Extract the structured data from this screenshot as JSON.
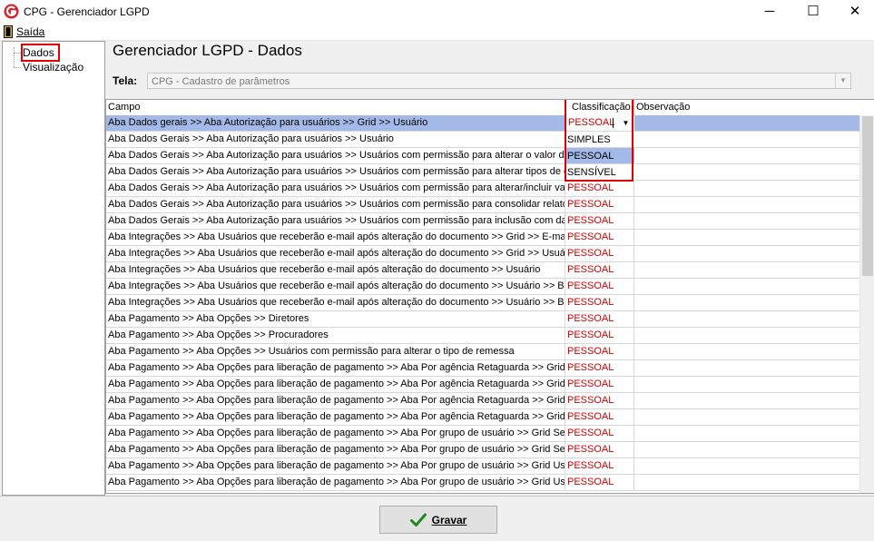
{
  "window": {
    "title": "CPG - Gerenciador LGPD",
    "minimize": "─",
    "maximize": "☐",
    "close": "✕"
  },
  "menu": {
    "exit_label": "Saída"
  },
  "tree": {
    "items": [
      "Dados",
      "Visualização"
    ]
  },
  "page": {
    "title": "Gerenciador LGPD - Dados",
    "tela_label": "Tela:",
    "tela_value": "CPG - Cadastro de parâmetros"
  },
  "grid": {
    "columns": [
      "Campo",
      "Classificação",
      "Observação"
    ],
    "rows": [
      {
        "campo": "Aba Dados gerais >> Aba Autorização para usuários >> Grid >> Usuário",
        "classificacao": "PESSOAL"
      },
      {
        "campo": "Aba Dados Gerais >> Aba Autorização para usuários >> Usuário",
        "classificacao": "PESSOAL"
      },
      {
        "campo": "Aba Dados Gerais >> Aba Autorização para usuários >> Usuários com permissão para alterar o valor de l...",
        "classificacao": "PESSOAL"
      },
      {
        "campo": "Aba Dados Gerais >> Aba Autorização para usuários >> Usuários com permissão para alterar tipos de de...",
        "classificacao": "PESSOAL"
      },
      {
        "campo": "Aba Dados Gerais >> Aba Autorização para usuários >> Usuários com permissão para alterar/incluir valor...",
        "classificacao": "PESSOAL"
      },
      {
        "campo": "Aba Dados Gerais >> Aba Autorização para usuários >> Usuários com permissão para consolidar relatóri...",
        "classificacao": "PESSOAL"
      },
      {
        "campo": "Aba Dados Gerais >> Aba Autorização para usuários >> Usuários com permissão para inclusão com data...",
        "classificacao": "PESSOAL"
      },
      {
        "campo": "Aba Integrações  >> Aba Usuários que receberão e-mail após alteração do documento >> Grid >> E-mail",
        "classificacao": "PESSOAL"
      },
      {
        "campo": "Aba Integrações  >> Aba Usuários que receberão e-mail após alteração do documento >> Grid >> Usuário",
        "classificacao": "PESSOAL"
      },
      {
        "campo": "Aba Integrações >> Aba Usuários que receberão e-mail após alteração do documento >> Usuário",
        "classificacao": "PESSOAL"
      },
      {
        "campo": "Aba Integrações >> Aba Usuários que receberão e-mail após alteração do documento >> Usuário >> Bro...",
        "classificacao": "PESSOAL"
      },
      {
        "campo": "Aba Integrações >> Aba Usuários que receberão e-mail após alteração do documento >> Usuário >> Bro...",
        "classificacao": "PESSOAL"
      },
      {
        "campo": "Aba Pagamento >> Aba Opções >> Diretores",
        "classificacao": "PESSOAL"
      },
      {
        "campo": "Aba Pagamento >> Aba Opções >> Procuradores",
        "classificacao": "PESSOAL"
      },
      {
        "campo": "Aba Pagamento >> Aba Opções >> Usuários com permissão para alterar o tipo de remessa",
        "classificacao": "PESSOAL"
      },
      {
        "campo": "Aba Pagamento >> Aba Opções para liberação de pagamento >> Aba Por agência Retaguarda >> Grid ...",
        "classificacao": "PESSOAL"
      },
      {
        "campo": "Aba Pagamento >> Aba Opções para liberação de pagamento >> Aba Por agência Retaguarda >> Grid ...",
        "classificacao": "PESSOAL"
      },
      {
        "campo": "Aba Pagamento >> Aba Opções para liberação de pagamento >> Aba Por agência Retaguarda >> Grid ...",
        "classificacao": "PESSOAL"
      },
      {
        "campo": "Aba Pagamento >> Aba Opções para liberação de pagamento >> Aba Por agência Retaguarda >> Grid ...",
        "classificacao": "PESSOAL"
      },
      {
        "campo": "Aba Pagamento >> Aba Opções para liberação de pagamento >> Aba Por grupo de usuário >> Grid Seto...",
        "classificacao": "PESSOAL"
      },
      {
        "campo": "Aba Pagamento >> Aba Opções para liberação de pagamento >> Aba Por grupo de usuário >> Grid Seto...",
        "classificacao": "PESSOAL"
      },
      {
        "campo": "Aba Pagamento >> Aba Opções para liberação de pagamento >> Aba Por grupo de usuário >> Grid Usu...",
        "classificacao": "PESSOAL"
      },
      {
        "campo": "Aba Pagamento >> Aba Opções para liberação de pagamento >> Aba Por grupo de usuário >> Grid Usu...",
        "classificacao": "PESSOAL"
      }
    ]
  },
  "dropdown": {
    "value": "PESSOAL",
    "options": [
      "SIMPLES",
      "PESSOAL",
      "SENSÍVEL"
    ],
    "selected_option": "PESSOAL"
  },
  "footer": {
    "save_label": "Gravar"
  },
  "colors": {
    "selection": "#a3b9e8",
    "classification_text": "#d00000",
    "highlight_box": "#e00000",
    "check_green": "#1e8a1e"
  }
}
